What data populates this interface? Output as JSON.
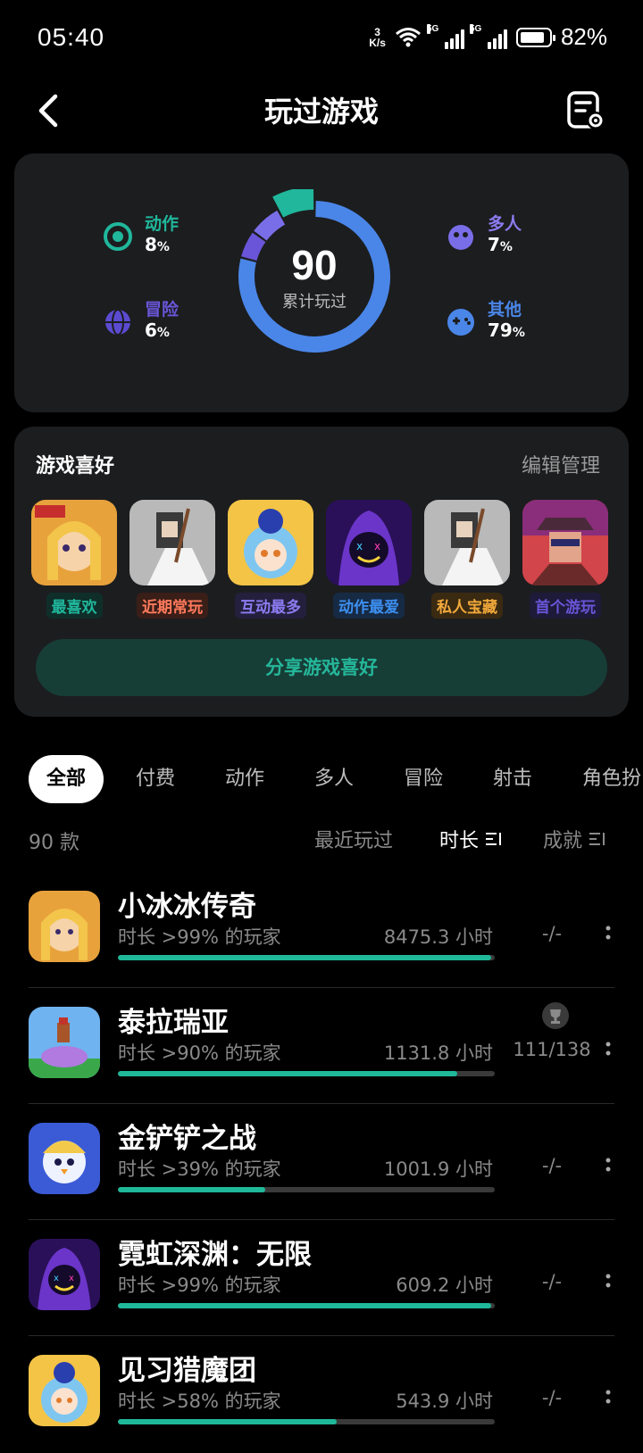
{
  "status": {
    "time": "05:40",
    "net_speed_top": "3",
    "net_speed_bottom": "K/s",
    "sig1": "5G",
    "sig2": "5G",
    "battery": "82%"
  },
  "header": {
    "title": "玩过游戏"
  },
  "stats": {
    "total": "90",
    "total_label": "累计玩过",
    "categories": [
      {
        "name": "动作",
        "pct": "8",
        "unit": "%",
        "color": "#20b79c"
      },
      {
        "name": "冒险",
        "pct": "6",
        "unit": "%",
        "color": "#6a55d8"
      },
      {
        "name": "多人",
        "pct": "7",
        "unit": "%",
        "color": "#7a6ee8"
      },
      {
        "name": "其他",
        "pct": "79",
        "unit": "%",
        "color": "#4a86e8"
      }
    ]
  },
  "preferences": {
    "title": "游戏喜好",
    "manage": "编辑管理",
    "items": [
      {
        "label": "最喜欢",
        "color": "#20b79c"
      },
      {
        "label": "近期常玩",
        "color": "#ff7a5c"
      },
      {
        "label": "互动最多",
        "color": "#8b7cf0"
      },
      {
        "label": "动作最爱",
        "color": "#3d8ff0"
      },
      {
        "label": "私人宝藏",
        "color": "#f2a93b"
      },
      {
        "label": "首个游玩",
        "color": "#6a55d8"
      }
    ],
    "share": "分享游戏喜好"
  },
  "tabs": [
    "全部",
    "付费",
    "动作",
    "多人",
    "冒险",
    "射击",
    "角色扮"
  ],
  "list_header": {
    "count": "90 款",
    "sort_recent": "最近玩过",
    "sort_duration": "时长",
    "sort_achievement": "成就"
  },
  "games": [
    {
      "name": "小冰冰传奇",
      "percentile": "时长 >99% 的玩家",
      "hours": "8475.3 小时",
      "achievement": "-/-",
      "progress": 0.99
    },
    {
      "name": "泰拉瑞亚",
      "percentile": "时长 >90% 的玩家",
      "hours": "1131.8 小时",
      "achievement": "111/138",
      "progress": 0.9
    },
    {
      "name": "金铲铲之战",
      "percentile": "时长 >39% 的玩家",
      "hours": "1001.9 小时",
      "achievement": "-/-",
      "progress": 0.39
    },
    {
      "name": "霓虹深渊：无限",
      "percentile": "时长 >99% 的玩家",
      "hours": "609.2 小时",
      "achievement": "-/-",
      "progress": 0.99
    },
    {
      "name": "见习猎魔团",
      "percentile": "时长 >58% 的玩家",
      "hours": "543.9 小时",
      "achievement": "-/-",
      "progress": 0.58
    }
  ]
}
